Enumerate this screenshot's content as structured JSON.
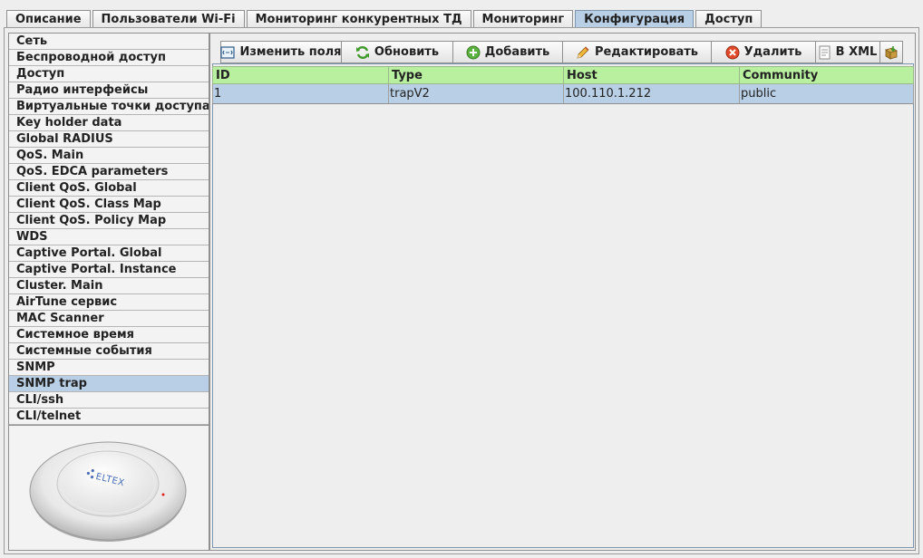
{
  "top_tabs": [
    {
      "label": "Описание",
      "active": false
    },
    {
      "label": "Пользователи Wi-Fi",
      "active": false
    },
    {
      "label": "Мониторинг конкурентных ТД",
      "active": false
    },
    {
      "label": "Мониторинг",
      "active": false
    },
    {
      "label": "Конфигурация",
      "active": true
    },
    {
      "label": "Доступ",
      "active": false
    }
  ],
  "sidebar": {
    "items": [
      {
        "label": "Сеть"
      },
      {
        "label": "Беспроводной доступ"
      },
      {
        "label": "Доступ"
      },
      {
        "label": "Радио интерфейсы"
      },
      {
        "label": "Виртуальные точки доступа"
      },
      {
        "label": "Key holder data"
      },
      {
        "label": "Global RADIUS"
      },
      {
        "label": "QoS. Main"
      },
      {
        "label": "QoS. EDCA parameters"
      },
      {
        "label": "Client QoS. Global"
      },
      {
        "label": "Client QoS. Class Map"
      },
      {
        "label": "Client QoS. Policy Map"
      },
      {
        "label": "WDS"
      },
      {
        "label": "Captive Portal. Global"
      },
      {
        "label": "Captive Portal. Instance"
      },
      {
        "label": "Cluster. Main"
      },
      {
        "label": "AirTune сервис"
      },
      {
        "label": "MAC Scanner"
      },
      {
        "label": "Системное время"
      },
      {
        "label": "Системные события"
      },
      {
        "label": "SNMP"
      },
      {
        "label": "SNMP trap"
      },
      {
        "label": "CLI/ssh"
      },
      {
        "label": "CLI/telnet"
      }
    ],
    "active_label": "SNMP trap",
    "device_logo": "ELTEX"
  },
  "toolbar": {
    "change_fields": "Изменить поля",
    "refresh": "Обновить",
    "add": "Добавить",
    "edit": "Редактировать",
    "delete": "Удалить",
    "to_xml": "В XML"
  },
  "table": {
    "columns": [
      "ID",
      "Type",
      "Host",
      "Community"
    ],
    "rows": [
      [
        "1",
        "trapV2",
        "100.110.1.212",
        "public"
      ]
    ]
  },
  "colors": {
    "selected": "#b8cfe5",
    "header_green": "#b9f0a0",
    "background": "#eeeeee"
  }
}
